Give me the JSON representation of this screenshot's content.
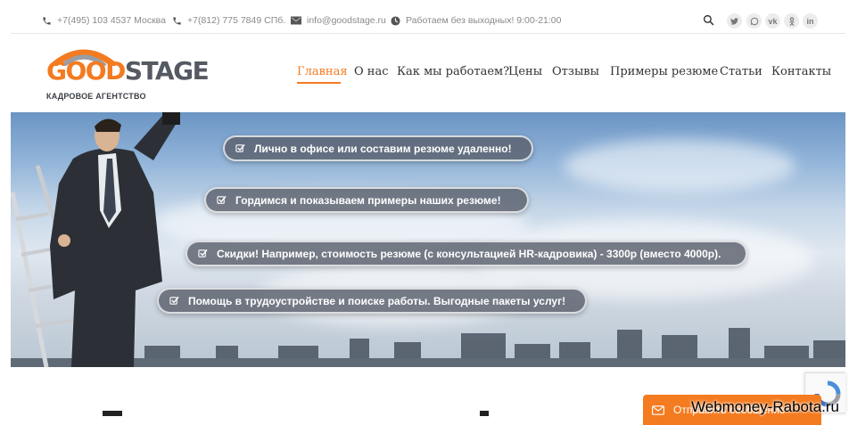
{
  "topbar": {
    "phone_moscow": "+7(495) 103 4537 Москва",
    "phone_spb": "+7(812) 775 7849 СПб.",
    "email": "info@goodstage.ru",
    "hours": "Работаем без выходных! 9:00-21:00",
    "social": [
      "twitter-icon",
      "whatsapp-icon",
      "vk-icon",
      "odnoklassniki-icon",
      "linkedin-icon"
    ]
  },
  "logo": {
    "word_good": "GOOD",
    "word_stage": "STAGE",
    "subtitle": "КАДРОВОЕ АГЕНТСТВО"
  },
  "nav": {
    "items": [
      {
        "label": "Главная",
        "active": true
      },
      {
        "label": "О нас"
      },
      {
        "label": "Как мы работаем?"
      },
      {
        "label": "Цены"
      },
      {
        "label": "Отзывы"
      },
      {
        "label": "Примеры резюме"
      },
      {
        "label": "Статьи"
      },
      {
        "label": "Контакты"
      }
    ]
  },
  "hero": {
    "pills": [
      "Лично в офисе или составим резюме удаленно!",
      "Гордимся и показываем примеры наших резюме!",
      "Скидки! Например, стоимость резюме (с консультацией HR-кадровика) - 3300р (вместо 4000р).",
      "Помощь в трудоустройстве и поиске работы. Выгодные пакеты услуг!"
    ]
  },
  "feedback": {
    "label": "Отправить сообщение"
  },
  "watermark": "Webmoney-Rabota.ru",
  "colors": {
    "accent": "#f47b20",
    "pill_bg": "#5a606c",
    "sky": "#8fb2d8"
  }
}
